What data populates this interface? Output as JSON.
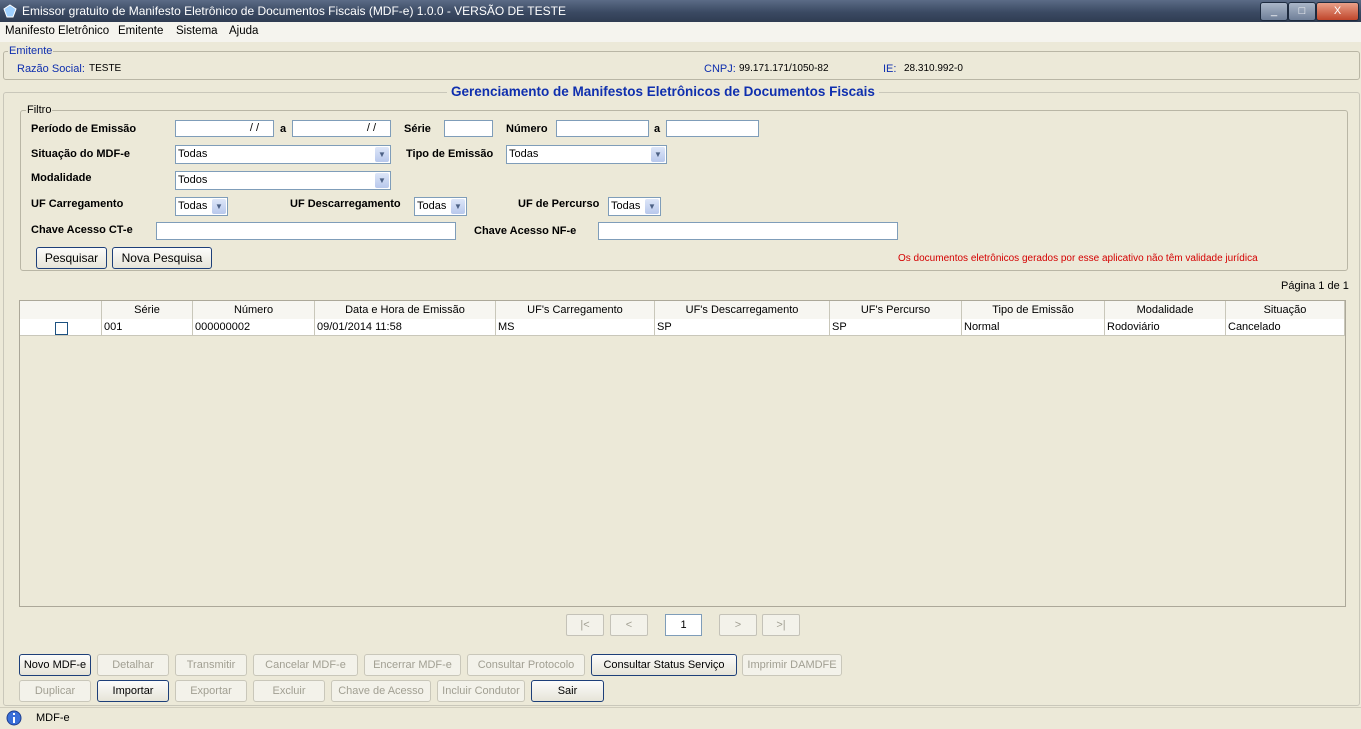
{
  "window": {
    "title": "Emissor gratuito de Manifesto Eletrônico de Documentos Fiscais (MDF-e) 1.0.0 - VERSÃO DE TESTE",
    "minimize": "_",
    "maximize": "□",
    "close": "X"
  },
  "menu": [
    "Manifesto Eletrônico",
    "Emitente",
    "Sistema",
    "Ajuda"
  ],
  "emitente": {
    "legend": "Emitente",
    "razao_label": "Razão Social:",
    "razao_value": "TESTE",
    "cnpj_label": "CNPJ:",
    "cnpj_value": "99.171.171/1050-82",
    "ie_label": "IE:",
    "ie_value": "28.310.992-0"
  },
  "main_title": "Gerenciamento de Manifestos Eletrônicos de Documentos Fiscais",
  "filtro": {
    "legend": "Filtro",
    "periodo_label": "Período de Emissão",
    "date_from": "  / /",
    "a1": "a",
    "date_to": "  / /",
    "serie_label": "Série",
    "serie_value": "",
    "numero_label": "Número",
    "numero_from": "",
    "a2": "a",
    "numero_to": "",
    "situacao_label": "Situação do MDF-e",
    "situacao_value": "Todas",
    "tipo_label": "Tipo de Emissão",
    "tipo_value": "Todas",
    "modalidade_label": "Modalidade",
    "modalidade_value": "Todos",
    "uf_carreg_label": "UF Carregamento",
    "uf_carreg_value": "Todas",
    "uf_descarreg_label": "UF Descarregamento",
    "uf_descarreg_value": "Todas",
    "uf_percurso_label": "UF de Percurso",
    "uf_percurso_value": "Todas",
    "chave_cte_label": "Chave Acesso CT-e",
    "chave_cte_value": "",
    "chave_nfe_label": "Chave Acesso NF-e",
    "chave_nfe_value": "",
    "pesquisar": "Pesquisar",
    "nova_pesquisa": "Nova Pesquisa",
    "warning": "Os documentos eletrônicos gerados por esse aplicativo não têm validade jurídica"
  },
  "pagination_label": "Página 1 de 1",
  "table": {
    "columns": [
      "",
      "Série",
      "Número",
      "Data e Hora de Emissão",
      "UF's Carregamento",
      "UF's Descarregamento",
      "UF's Percurso",
      "Tipo de Emissão",
      "Modalidade",
      "Situação"
    ],
    "rows": [
      [
        "",
        "001",
        "000000002",
        "09/01/2014 11:58",
        "MS",
        "SP",
        "SP",
        "Normal",
        "Rodoviário",
        "Cancelado"
      ]
    ]
  },
  "pager": {
    "first": "|<",
    "prev": "<",
    "page": "1",
    "next": ">",
    "last": ">|"
  },
  "actions_row1": [
    "Novo MDF-e",
    "Detalhar",
    "Transmitir",
    "Cancelar MDF-e",
    "Encerrar MDF-e",
    "Consultar Protocolo",
    "Consultar Status Serviço",
    "Imprimir DAMDFE"
  ],
  "actions_row2": [
    "Duplicar",
    "Importar",
    "Exportar",
    "Excluir",
    "Chave de Acesso",
    "Incluir Condutor",
    "Sair"
  ],
  "status": {
    "text": "MDF-e"
  },
  "colors": {
    "accent_blue": "#0f2fae",
    "warning_red": "#d40000"
  }
}
